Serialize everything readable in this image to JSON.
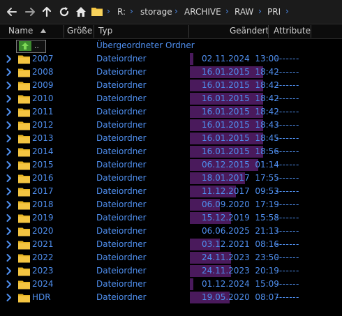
{
  "path": [
    "R:",
    "storage",
    "ARCHIVE",
    "RAW",
    "PRI"
  ],
  "columns": {
    "name": "Name",
    "size": "Größe",
    "type": "Typ",
    "modified": "Geändert",
    "attributes": "Attribute"
  },
  "parent_row": {
    "label": "..",
    "type": "Übergeordneter Ordner"
  },
  "rows": [
    {
      "name": "2007",
      "type": "Dateiordner",
      "modified": "02.11.2024  13:00",
      "attributes": "-------",
      "activity": 0.05
    },
    {
      "name": "2008",
      "type": "Dateiordner",
      "modified": "16.01.2015  18:42",
      "attributes": "-------",
      "activity": 0.98
    },
    {
      "name": "2009",
      "type": "Dateiordner",
      "modified": "16.01.2015  18:42",
      "attributes": "-------",
      "activity": 0.98
    },
    {
      "name": "2010",
      "type": "Dateiordner",
      "modified": "16.01.2015  18:42",
      "attributes": "-------",
      "activity": 0.98
    },
    {
      "name": "2011",
      "type": "Dateiordner",
      "modified": "16.01.2015  18:42",
      "attributes": "-------",
      "activity": 0.98
    },
    {
      "name": "2012",
      "type": "Dateiordner",
      "modified": "16.01.2015  18:43",
      "attributes": "-------",
      "activity": 0.98
    },
    {
      "name": "2013",
      "type": "Dateiordner",
      "modified": "16.01.2015  18:45",
      "attributes": "-------",
      "activity": 0.98
    },
    {
      "name": "2014",
      "type": "Dateiordner",
      "modified": "16.01.2015  18:56",
      "attributes": "-------",
      "activity": 0.98
    },
    {
      "name": "2015",
      "type": "Dateiordner",
      "modified": "06.12.2015  01:14",
      "attributes": "-------",
      "activity": 0.92
    },
    {
      "name": "2016",
      "type": "Dateiordner",
      "modified": "18.01.2017  17:55",
      "attributes": "-------",
      "activity": 0.74
    },
    {
      "name": "2017",
      "type": "Dateiordner",
      "modified": "11.12.2017  09:53",
      "attributes": "-------",
      "activity": 0.62
    },
    {
      "name": "2018",
      "type": "Dateiordner",
      "modified": "06.09.2020  17:19",
      "attributes": "-------",
      "activity": 0.4
    },
    {
      "name": "2019",
      "type": "Dateiordner",
      "modified": "15.12.2019  15:58",
      "attributes": "-------",
      "activity": 0.55
    },
    {
      "name": "2020",
      "type": "Dateiordner",
      "modified": "06.06.2025  21:13",
      "attributes": "-------",
      "activity": 0.0
    },
    {
      "name": "2021",
      "type": "Dateiordner",
      "modified": "03.12.2021  08:16",
      "attributes": "-------",
      "activity": 0.4
    },
    {
      "name": "2022",
      "type": "Dateiordner",
      "modified": "24.11.2023  23:50",
      "attributes": "-------",
      "activity": 0.55
    },
    {
      "name": "2023",
      "type": "Dateiordner",
      "modified": "24.11.2023  20:19",
      "attributes": "-------",
      "activity": 0.55
    },
    {
      "name": "2024",
      "type": "Dateiordner",
      "modified": "01.12.2024  15:09",
      "attributes": "-------",
      "activity": 0.05
    },
    {
      "name": "HDR",
      "type": "Dateiordner",
      "modified": "19.05.2020  08:07",
      "attributes": "-------",
      "activity": 0.53
    }
  ],
  "colors": {
    "text_accent": "#4f8fef",
    "date_bar": "#4a1a5c",
    "folder": "#f4c542",
    "background": "#000000"
  },
  "icons": {
    "back": "arrow-left-icon",
    "forward": "arrow-right-icon",
    "up": "arrow-up-icon",
    "refresh": "refresh-icon",
    "home": "home-icon",
    "folder": "folder-icon",
    "expand": "chevron-right-icon",
    "sort": "sort-ascending-icon"
  }
}
